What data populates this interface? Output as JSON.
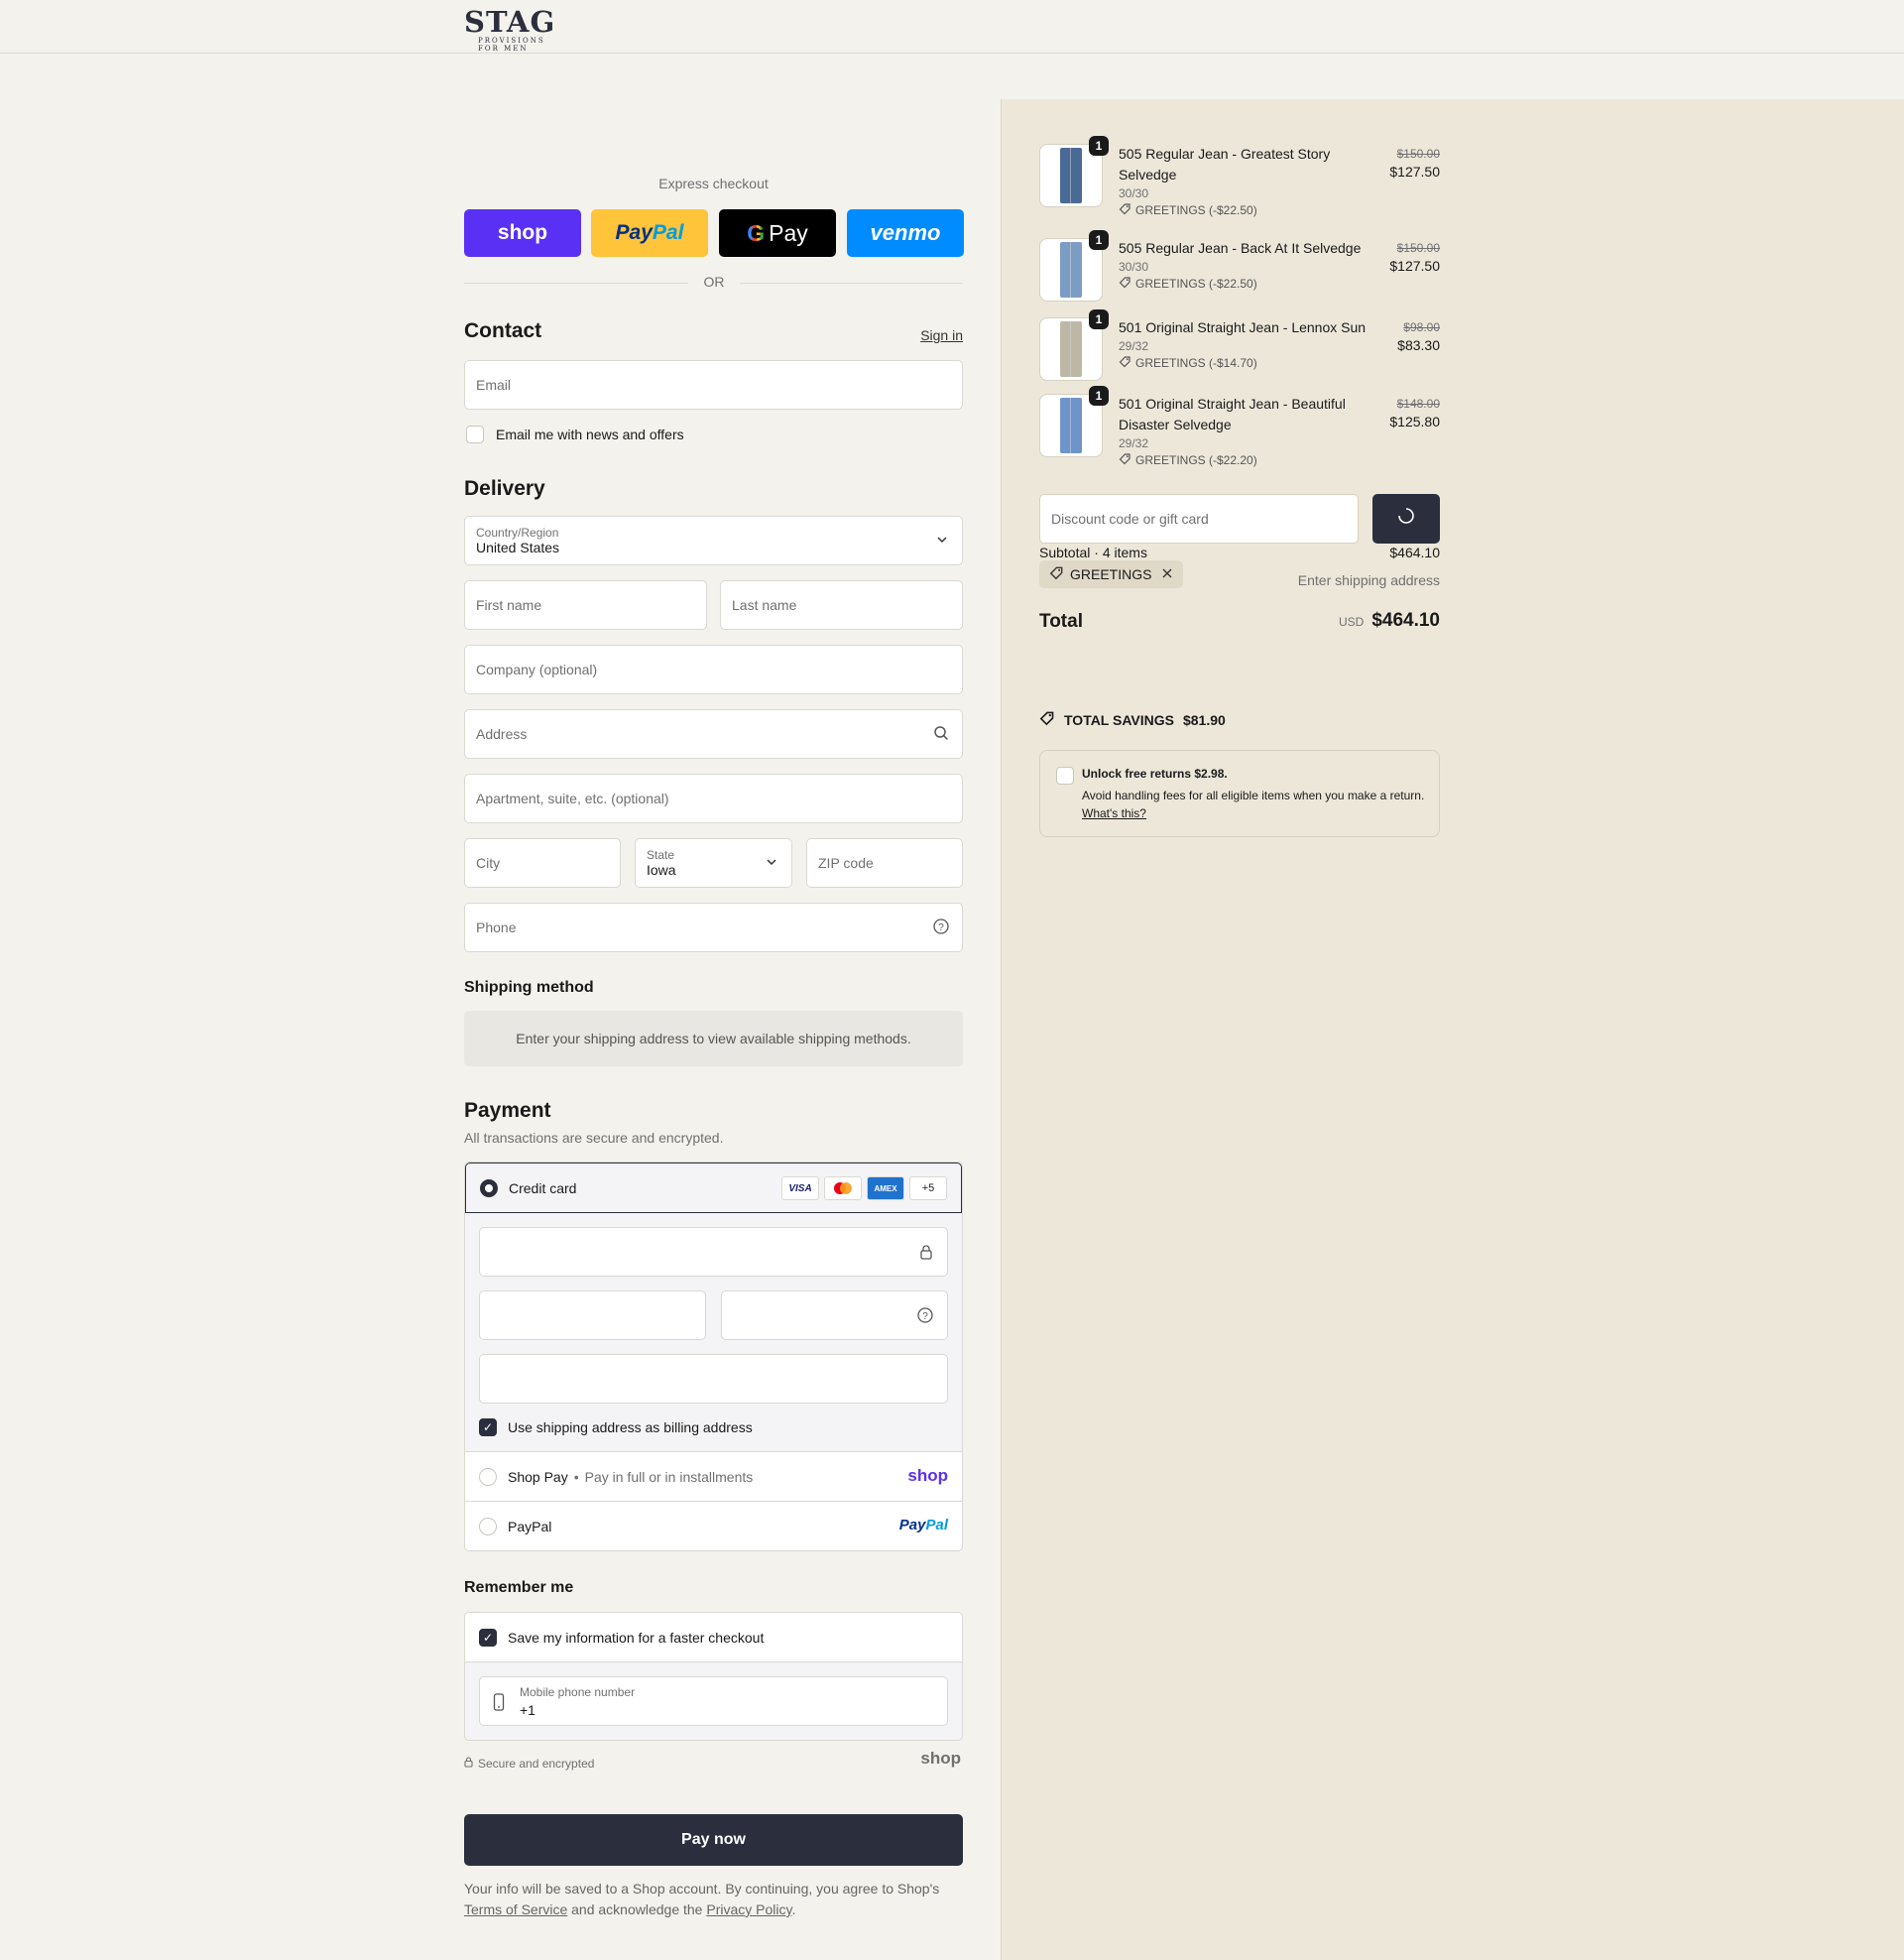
{
  "brand": {
    "logo_main": "STAG",
    "logo_sub": "PROVISIONS FOR MEN"
  },
  "express": {
    "label": "Express checkout",
    "shop": "shop",
    "paypal_a": "Pay",
    "paypal_b": "Pal",
    "gpay": "Pay",
    "venmo": "venmo",
    "or": "OR"
  },
  "contact": {
    "title": "Contact",
    "sign_in": "Sign in",
    "email_placeholder": "Email",
    "news_label": "Email me with news and offers"
  },
  "delivery": {
    "title": "Delivery",
    "country_label": "Country/Region",
    "country_value": "United States",
    "first_name": "First name",
    "last_name": "Last name",
    "company": "Company (optional)",
    "address": "Address",
    "apartment": "Apartment, suite, etc. (optional)",
    "city": "City",
    "state_label": "State",
    "state_value": "Iowa",
    "zip": "ZIP code",
    "phone": "Phone"
  },
  "shipping": {
    "title": "Shipping method",
    "message": "Enter your shipping address to view available shipping methods."
  },
  "payment": {
    "title": "Payment",
    "subtitle": "All transactions are secure and encrypted.",
    "credit_card": "Credit card",
    "cards": [
      "VISA",
      "MC",
      "AMEX",
      "+5"
    ],
    "billing_label": "Use shipping address as billing address",
    "shop_pay": "Shop Pay",
    "shop_pay_sub": "Pay in full or in installments",
    "shop_pay_logo": "shop",
    "paypal": "PayPal",
    "paypal_logo_a": "Pay",
    "paypal_logo_b": "Pal"
  },
  "remember": {
    "title": "Remember me",
    "save_label": "Save my information for a faster checkout",
    "mobile_label": "Mobile phone number",
    "mobile_value": "+1",
    "secure": "Secure and encrypted",
    "shop_logo": "shop"
  },
  "pay_now": "Pay now",
  "legal": {
    "text1": "Your info will be saved to a Shop account. By continuing, you agree to Shop's",
    "terms": "Terms of Service",
    "text2": "and acknowledge the",
    "privacy": "Privacy Policy",
    "text3": "."
  },
  "cart": {
    "items": [
      {
        "qty": "1",
        "name": "505 Regular Jean - Greatest Story Selvedge",
        "variant": "30/30",
        "discount": "GREETINGS (-$22.50)",
        "old_price": "$150.00",
        "price": "$127.50",
        "color": "#4a6a96"
      },
      {
        "qty": "1",
        "name": "505 Regular Jean - Back At It Selvedge",
        "variant": "30/30",
        "discount": "GREETINGS (-$22.50)",
        "old_price": "$150.00",
        "price": "$127.50",
        "color": "#7d9cc4"
      },
      {
        "qty": "1",
        "name": "501 Original Straight Jean - Lennox Sun",
        "variant": "29/32",
        "discount": "GREETINGS (-$14.70)",
        "old_price": "$98.00",
        "price": "$83.30",
        "color": "#bdb8a6"
      },
      {
        "qty": "1",
        "name": "501 Original Straight Jean - Beautiful Disaster Selvedge",
        "variant": "29/32",
        "discount": "GREETINGS (-$22.20)",
        "old_price": "$148.00",
        "price": "$125.80",
        "color": "#6e95c9"
      }
    ],
    "discount_placeholder": "Discount code or gift card",
    "subtotal_label": "Subtotal · 4 items",
    "subtotal_value": "$464.10",
    "code_chip": "GREETINGS",
    "shipping_note": "Enter shipping address",
    "total_label": "Total",
    "currency": "USD",
    "total_value": "$464.10",
    "savings_label": "TOTAL SAVINGS",
    "savings_value": "$81.90",
    "returns_title": "Unlock free returns $2.98.",
    "returns_body": "Avoid handling fees for all eligible items when you make a return.",
    "returns_link": "What's this?"
  }
}
